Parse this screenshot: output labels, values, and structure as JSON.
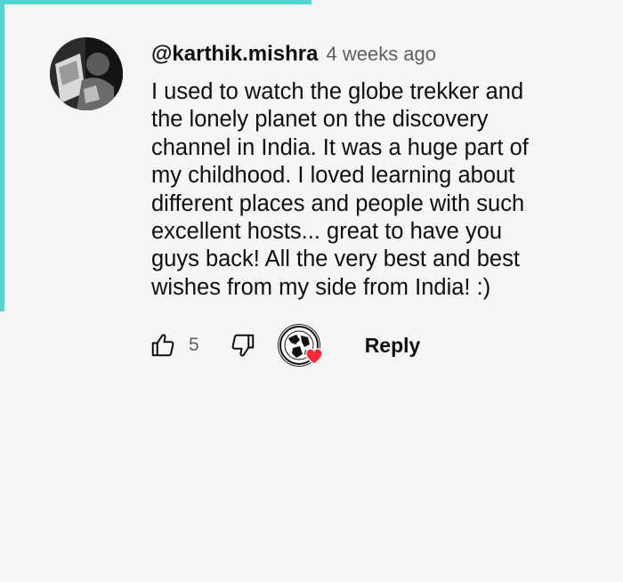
{
  "comment": {
    "author": "@karthik.mishra",
    "timestamp": "4 weeks ago",
    "text": "I used to watch the globe trekker and\nthe lonely planet on the discovery\nchannel in India. It was a huge part of\nmy childhood. I loved learning about\ndifferent places and people with such\nexcellent hosts... great to have you\nguys back! All the very best and best\nwishes from my side from India!  :)"
  },
  "actions": {
    "like_count": "5",
    "reply_label": "Reply"
  },
  "icons": {
    "like": "thumbs-up-icon",
    "dislike": "thumbs-down-icon",
    "creator_heart": "heart-icon"
  },
  "colors": {
    "accent": "#55d6d3",
    "heart": "#ff2b3b",
    "background": "#f6f6f6"
  }
}
